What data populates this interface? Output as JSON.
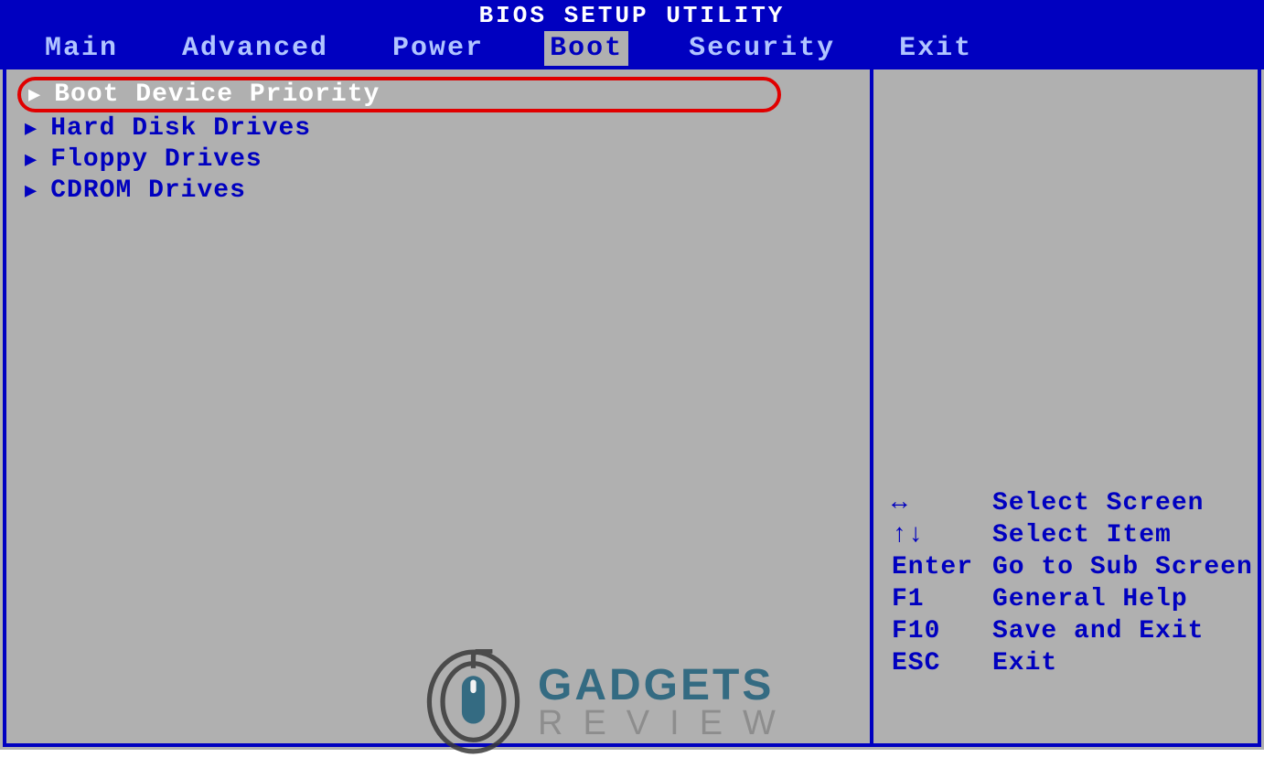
{
  "header": {
    "title": "BIOS SETUP UTILITY",
    "tabs": [
      {
        "label": "Main",
        "active": false
      },
      {
        "label": "Advanced",
        "active": false
      },
      {
        "label": "Power",
        "active": false
      },
      {
        "label": "Boot",
        "active": true
      },
      {
        "label": "Security",
        "active": false
      },
      {
        "label": "Exit",
        "active": false
      }
    ]
  },
  "menu": {
    "items": [
      {
        "label": "Boot Device Priority",
        "selected": true
      },
      {
        "label": "Hard Disk Drives",
        "selected": false
      },
      {
        "label": "Floppy Drives",
        "selected": false
      },
      {
        "label": "CDROM Drives",
        "selected": false
      }
    ]
  },
  "help": {
    "rows": [
      {
        "key": "↔",
        "desc": "Select Screen"
      },
      {
        "key": "↑↓",
        "desc": "Select Item"
      },
      {
        "key": "Enter",
        "desc": "Go to Sub Screen"
      },
      {
        "key": "F1",
        "desc": "General Help"
      },
      {
        "key": "F10",
        "desc": "Save and Exit"
      },
      {
        "key": "ESC",
        "desc": "Exit"
      }
    ]
  },
  "watermark": {
    "top": "GADGETS",
    "bottom": "REVIEW"
  },
  "colors": {
    "blue": "#0000c0",
    "gray": "#b0b0b0",
    "highlight_red": "#e00000",
    "white": "#ffffff"
  }
}
